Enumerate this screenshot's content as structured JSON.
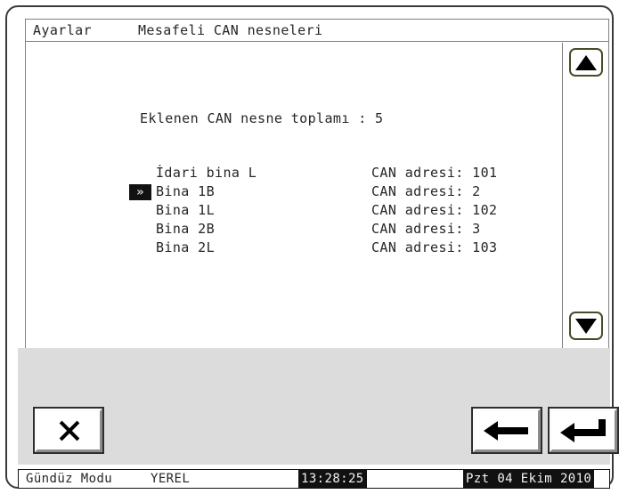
{
  "window": {
    "title_app": "Ayarlar",
    "title_page": "Mesafeli CAN nesneleri"
  },
  "content": {
    "total_label": "Eklenen CAN nesne toplamı : 5",
    "total_count": 5
  },
  "list": {
    "selected_index": 1,
    "marker_glyph": "»",
    "rows": [
      {
        "marker": "",
        "name": "İdari bina L",
        "address": "CAN adresi: 101",
        "selected": false
      },
      {
        "marker": "»",
        "name": "Bina 1B",
        "address": "CAN adresi: 2",
        "selected": true
      },
      {
        "marker": "",
        "name": "Bina 1L",
        "address": "CAN adresi: 102",
        "selected": false
      },
      {
        "marker": "",
        "name": "Bina 2B",
        "address": "CAN adresi: 3",
        "selected": false
      },
      {
        "marker": "",
        "name": "Bina 2L",
        "address": "CAN adresi: 103",
        "selected": false
      }
    ]
  },
  "scrollbar": {
    "up_icon": "scroll-up-arrow-icon",
    "down_icon": "scroll-down-arrow-icon"
  },
  "toolbar": {
    "cancel_icon": "close-x-icon",
    "back_icon": "left-arrow-icon",
    "enter_icon": "enter-return-arrow-icon"
  },
  "status_bar": {
    "mode": "Gündüz Modu",
    "zone": "YEREL",
    "time": "13:28:25",
    "date": "Pzt 04 Ekim 2010"
  },
  "colors": {
    "frame": "#3a3a3a",
    "panel_border": "#808080",
    "toolbar_bg": "#dcdcdc",
    "text": "#262626",
    "inverse_bg": "#111111",
    "inverse_text": "#f2f2f2",
    "scroll_btn_border": "#4a4a28"
  }
}
